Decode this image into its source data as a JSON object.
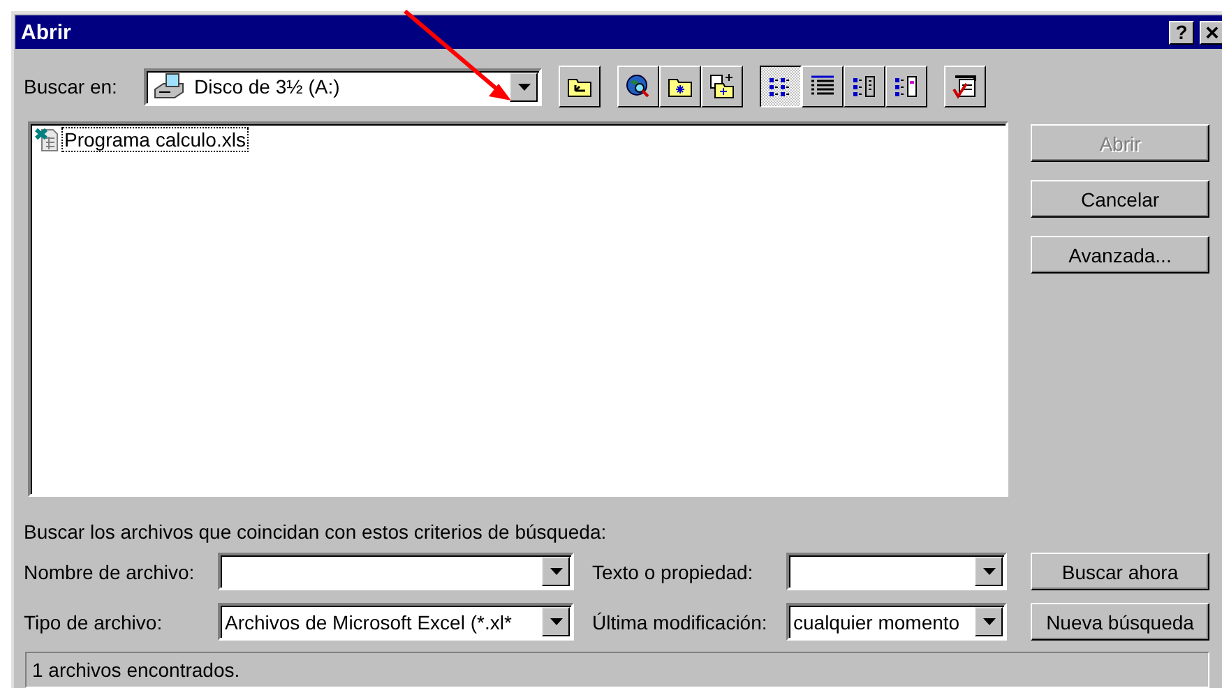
{
  "window": {
    "title": "Abrir",
    "title_buttons": [
      {
        "kind": "help",
        "label": "?"
      },
      {
        "kind": "close",
        "label": "×"
      }
    ]
  },
  "look_in": {
    "label": "Buscar en:",
    "value": "Disco de 3½ (A:)"
  },
  "toolbar": [
    {
      "kind": "up-folder",
      "selected": false
    },
    {
      "kind": "sep"
    },
    {
      "kind": "web-search",
      "selected": false
    },
    {
      "kind": "favorites",
      "selected": false
    },
    {
      "kind": "add-favorite",
      "selected": false
    },
    {
      "kind": "sep"
    },
    {
      "kind": "list-view",
      "selected": true
    },
    {
      "kind": "details-view",
      "selected": false
    },
    {
      "kind": "properties-view",
      "selected": false
    },
    {
      "kind": "preview-view",
      "selected": false
    },
    {
      "kind": "sep"
    },
    {
      "kind": "commands",
      "selected": false
    }
  ],
  "files": [
    {
      "name": "Programa calculo.xls",
      "focused": true
    }
  ],
  "buttons": [
    {
      "label": "Abrir",
      "disabled": true
    },
    {
      "label": "Cancelar",
      "disabled": false
    },
    {
      "label": "Avanzada...",
      "disabled": false
    }
  ],
  "criteria": {
    "heading": "Buscar los archivos que coincidan con estos criterios de búsqueda:",
    "rows": [
      {
        "left": {
          "label": "Nombre de archivo:"
        },
        "right": {
          "label": "Texto o propiedad:"
        },
        "button": "Buscar ahora"
      },
      {
        "left": {
          "label": "Tipo de archivo:",
          "value": "Archivos de Microsoft Excel (*.xl*"
        },
        "right": {
          "label": "Última modificación:",
          "value": "cualquier momento"
        },
        "button": "Nueva búsqueda"
      }
    ]
  },
  "status_bar": "1 archivos encontrados."
}
